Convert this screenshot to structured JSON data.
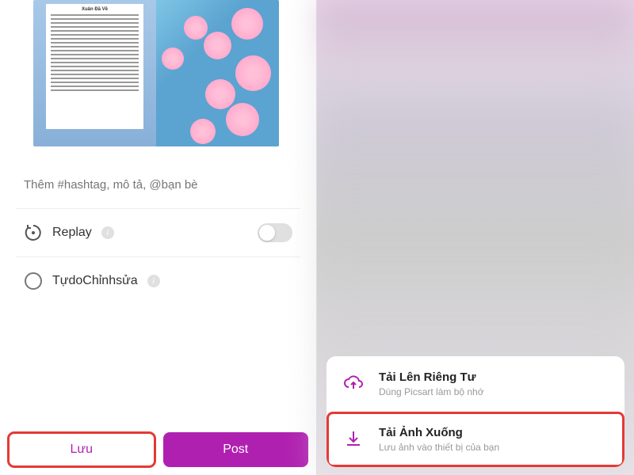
{
  "preview": {
    "sheet_title": "Xuân Đã Về"
  },
  "hashtag": {
    "placeholder": "Thêm #hashtag, mô tả, @bạn bè"
  },
  "options": {
    "replay": {
      "label": "Replay",
      "toggled": false
    },
    "free_edit": {
      "label": "TựdoChỉnhsửa"
    }
  },
  "buttons": {
    "save": "Lưu",
    "post": "Post"
  },
  "action_sheet": {
    "upload_private": {
      "title": "Tải Lên Riêng Tư",
      "subtitle": "Dùng Picsart làm bộ nhớ"
    },
    "download": {
      "title": "Tải Ảnh Xuống",
      "subtitle": "Lưu ảnh vào thiết bị của bạn"
    }
  },
  "colors": {
    "accent": "#b020b0",
    "highlight": "#e53935"
  }
}
